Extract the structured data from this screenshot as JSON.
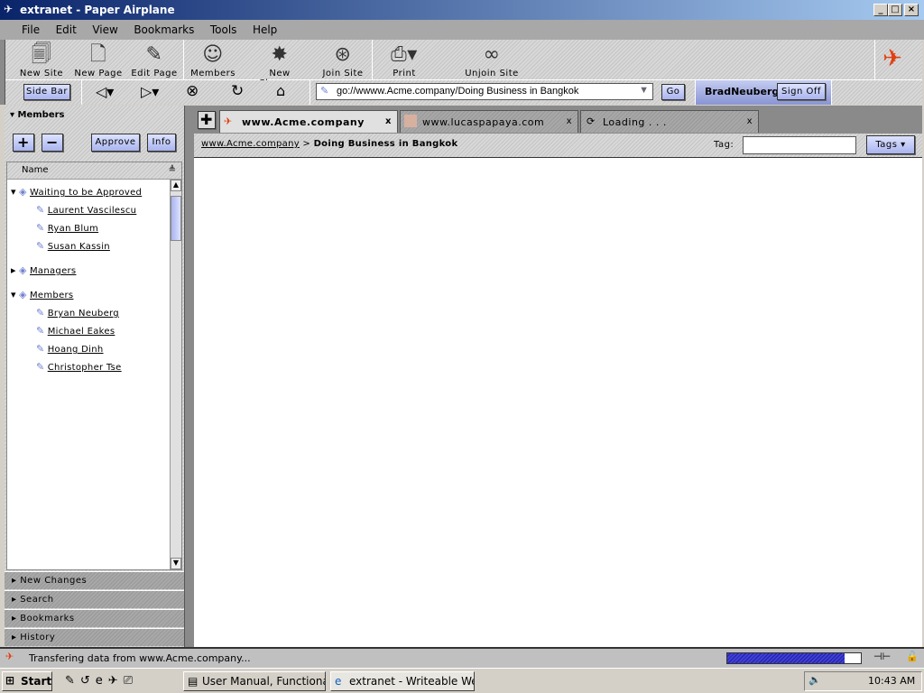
{
  "window": {
    "title": "extranet - Paper Airplane",
    "controls": [
      "_",
      "□",
      "×"
    ]
  },
  "menu": [
    "File",
    "Edit",
    "View",
    "Bookmarks",
    "Tools",
    "Help"
  ],
  "toolbar": [
    {
      "label": "New Site",
      "icon": "new-site-icon"
    },
    {
      "label": "New Page",
      "icon": "new-page-icon"
    },
    {
      "label": "Edit Page",
      "icon": "edit-page-icon"
    },
    {
      "label": "Members",
      "icon": "members-icon"
    },
    {
      "label": "New Changes",
      "icon": "new-changes-icon"
    },
    {
      "label": "Join Site",
      "icon": "join-site-icon"
    },
    {
      "label": "Print",
      "icon": "printer-icon"
    },
    {
      "label": "Unjoin Site",
      "icon": "unjoin-site-icon"
    }
  ],
  "nav": {
    "sidebar_label": "Side Bar",
    "address": "go://wwww.Acme.company/Doing Business in Bangkok",
    "go_label": "Go",
    "user": "BradNeuberg",
    "signoff_label": "Sign Off"
  },
  "sidebar": {
    "title": "Members",
    "add": "+",
    "remove": "−",
    "approve": "Approve",
    "info": "Info",
    "column": "Name",
    "groups": [
      {
        "name": "Waiting to be Approved",
        "expanded": true,
        "members": [
          "Laurent Vascilescu",
          "Ryan Blum",
          "Susan Kassin"
        ]
      },
      {
        "name": "Managers",
        "expanded": false,
        "members": []
      },
      {
        "name": "Members",
        "expanded": true,
        "members": [
          "Bryan Neuberg",
          "Michael Eakes",
          "Hoang Dinh",
          "Christopher Tse"
        ]
      }
    ],
    "panels": [
      "New Changes",
      "Search",
      "Bookmarks",
      "History"
    ]
  },
  "tabs": [
    {
      "label": "www.Acme.company",
      "active": true
    },
    {
      "label": "www.lucaspapaya.com",
      "active": false
    },
    {
      "label": "Loading . . .",
      "active": false
    }
  ],
  "breadcrumb": {
    "link": "www.Acme.company",
    "separator": ">",
    "current": "Doing Business in Bangkok"
  },
  "tag": {
    "label": "Tag:",
    "value": "",
    "button": "Tags ▾"
  },
  "status": {
    "text": "Transfering data from www.Acme.company...",
    "progress_percent": 88
  },
  "taskbar": {
    "start": "Start",
    "tasks": [
      "User Manual, Functional ...",
      "extranet - Writeable Web..."
    ],
    "clock": "10:43 AM"
  },
  "colors": {
    "accent": "#a9b4ee",
    "titlebar": "#0a246a",
    "progress": "#3a3ad0"
  }
}
